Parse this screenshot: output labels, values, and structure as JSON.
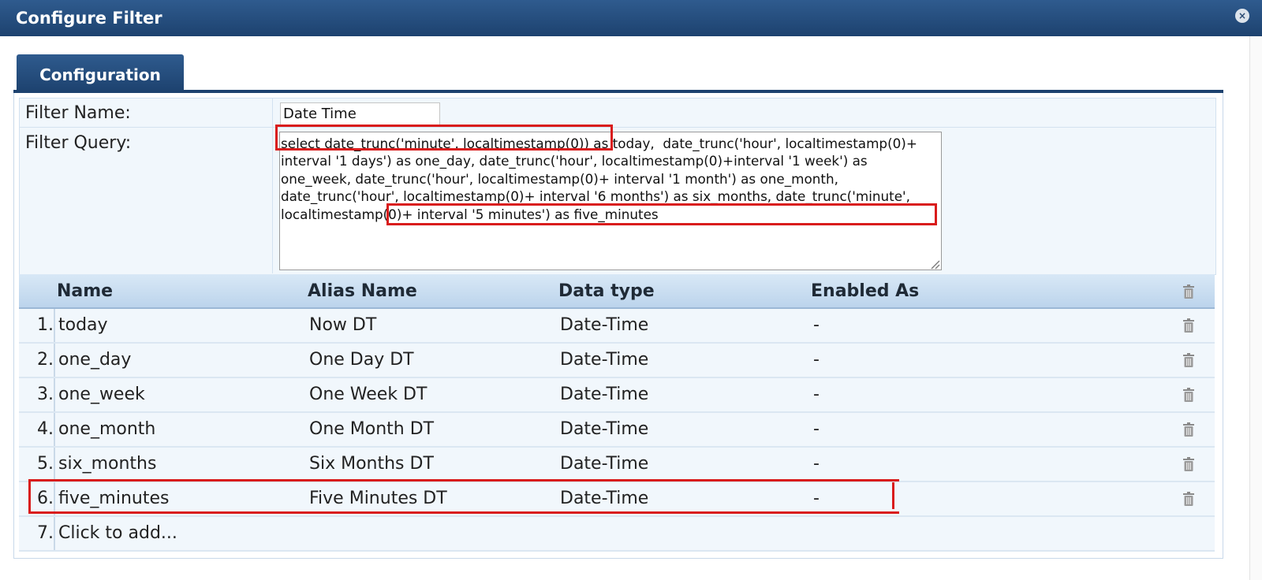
{
  "window": {
    "title": "Configure Filter",
    "close_label": "×"
  },
  "tabs": [
    {
      "label": "Configuration"
    }
  ],
  "form": {
    "filter_name_label": "Filter Name:",
    "filter_name_value": "Date Time",
    "filter_query_label": "Filter Query:",
    "filter_query_value": "select date_trunc('minute', localtimestamp(0)) as today,  date_trunc('hour', localtimestamp(0)+ interval '1 days') as one_day, date_trunc('hour', localtimestamp(0)+interval '1 week') as one_week, date_trunc('hour', localtimestamp(0)+ interval '1 month') as one_month, date_trunc('hour', localtimestamp(0)+ interval '6 months') as six_months, date_trunc('minute', localtimestamp(0)+ interval '5 minutes') as five_minutes"
  },
  "grid": {
    "columns": [
      "Name",
      "Alias Name",
      "Data type",
      "Enabled As"
    ],
    "rows": [
      {
        "num": "1.",
        "name": "today",
        "alias": "Now DT",
        "type": "Date-Time",
        "enabled": "-"
      },
      {
        "num": "2.",
        "name": "one_day",
        "alias": "One Day DT",
        "type": "Date-Time",
        "enabled": "-"
      },
      {
        "num": "3.",
        "name": "one_week",
        "alias": "One Week DT",
        "type": "Date-Time",
        "enabled": "-"
      },
      {
        "num": "4.",
        "name": "one_month",
        "alias": "One Month DT",
        "type": "Date-Time",
        "enabled": "-"
      },
      {
        "num": "5.",
        "name": "six_months",
        "alias": "Six Months DT",
        "type": "Date-Time",
        "enabled": "-"
      },
      {
        "num": "6.",
        "name": "five_minutes",
        "alias": "Five Minutes DT",
        "type": "Date-Time",
        "enabled": "-"
      }
    ],
    "add_row": {
      "num": "7.",
      "label": "Click to add..."
    }
  },
  "icons": {
    "close": "close-icon",
    "delete": "trash-icon",
    "resize": "resize-grip-icon"
  },
  "colors": {
    "title_bar": "#1d426f",
    "highlight": "#d91c1c",
    "grid_header": "#bcd4ec",
    "row_bg": "#f1f7fc"
  }
}
